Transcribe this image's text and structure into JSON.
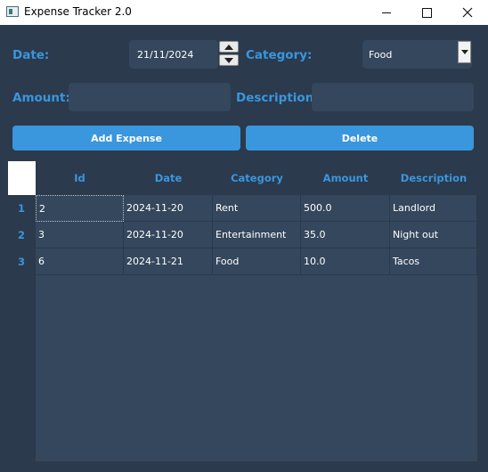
{
  "window": {
    "title": "Expense Tracker 2.0",
    "controls": [
      "minimize",
      "maximize",
      "close"
    ]
  },
  "form": {
    "date_label": "Date:",
    "date_value": "21/11/2024",
    "category_label": "Category:",
    "category_value": "Food",
    "amount_label": "Amount:",
    "amount_value": "",
    "description_label": "Description:",
    "description_value": ""
  },
  "buttons": {
    "add_label": "Add Expense",
    "delete_label": "Delete"
  },
  "table": {
    "columns": [
      "Id",
      "Date",
      "Category",
      "Amount",
      "Description"
    ],
    "row_headers": [
      "1",
      "2",
      "3"
    ],
    "rows": [
      [
        "2",
        "2024-11-20",
        "Rent",
        "500.0",
        "Landlord"
      ],
      [
        "3",
        "2024-11-20",
        "Entertainment",
        "35.0",
        "Night out"
      ],
      [
        "6",
        "2024-11-21",
        "Food",
        "10.0",
        "Tacos"
      ]
    ]
  },
  "colors": {
    "background": "#2b3a4d",
    "field": "#34475c",
    "accent": "#3a96dd",
    "text": "#ffffff"
  }
}
